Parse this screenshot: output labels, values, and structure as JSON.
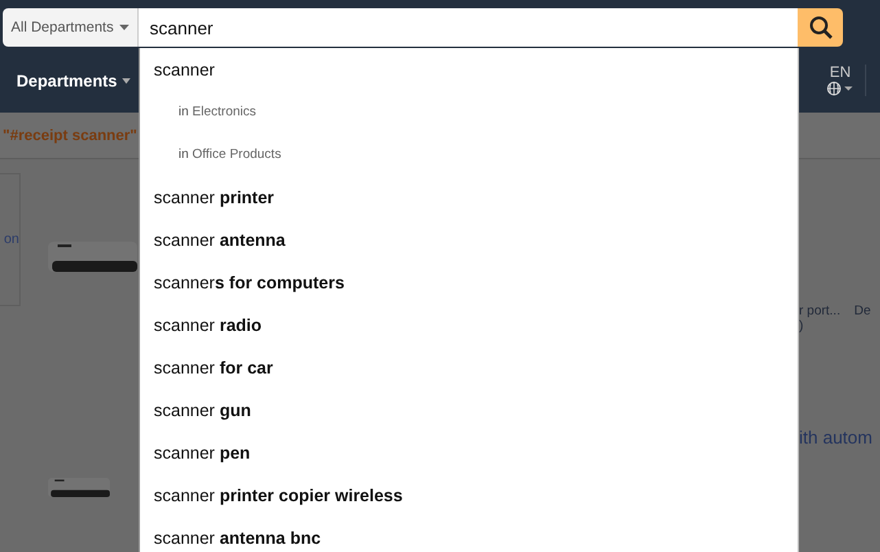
{
  "search": {
    "department": "All Departments",
    "value": "scanner"
  },
  "nav": {
    "departments": "Departments",
    "language": "EN"
  },
  "results_bar": {
    "query": "\"#receipt scanner\""
  },
  "filter_panel": {
    "text": "on"
  },
  "results": [
    {
      "title": "r port...",
      "line_2": ")",
      "column_2": "De"
    },
    {
      "title": "ith autom"
    }
  ],
  "suggestions": [
    {
      "kind": "query",
      "text": "scanner"
    },
    {
      "kind": "category",
      "prefix": "in",
      "text": "Electronics"
    },
    {
      "kind": "category",
      "prefix": "in",
      "text": "Office Products"
    },
    {
      "kind": "query",
      "text": "scanner **printer**"
    },
    {
      "kind": "query",
      "text": "scanner **antenna**"
    },
    {
      "kind": "query",
      "text": "scanner**s for computers**"
    },
    {
      "kind": "query",
      "text": "scanner **radio**"
    },
    {
      "kind": "query",
      "text": "scanner **for car**"
    },
    {
      "kind": "query",
      "text": "scanner **gun**"
    },
    {
      "kind": "query",
      "text": "scanner **pen**"
    },
    {
      "kind": "query",
      "text": "scanner **printer copier wireless**"
    },
    {
      "kind": "query",
      "text": "scanner **antenna bnc**"
    }
  ]
}
